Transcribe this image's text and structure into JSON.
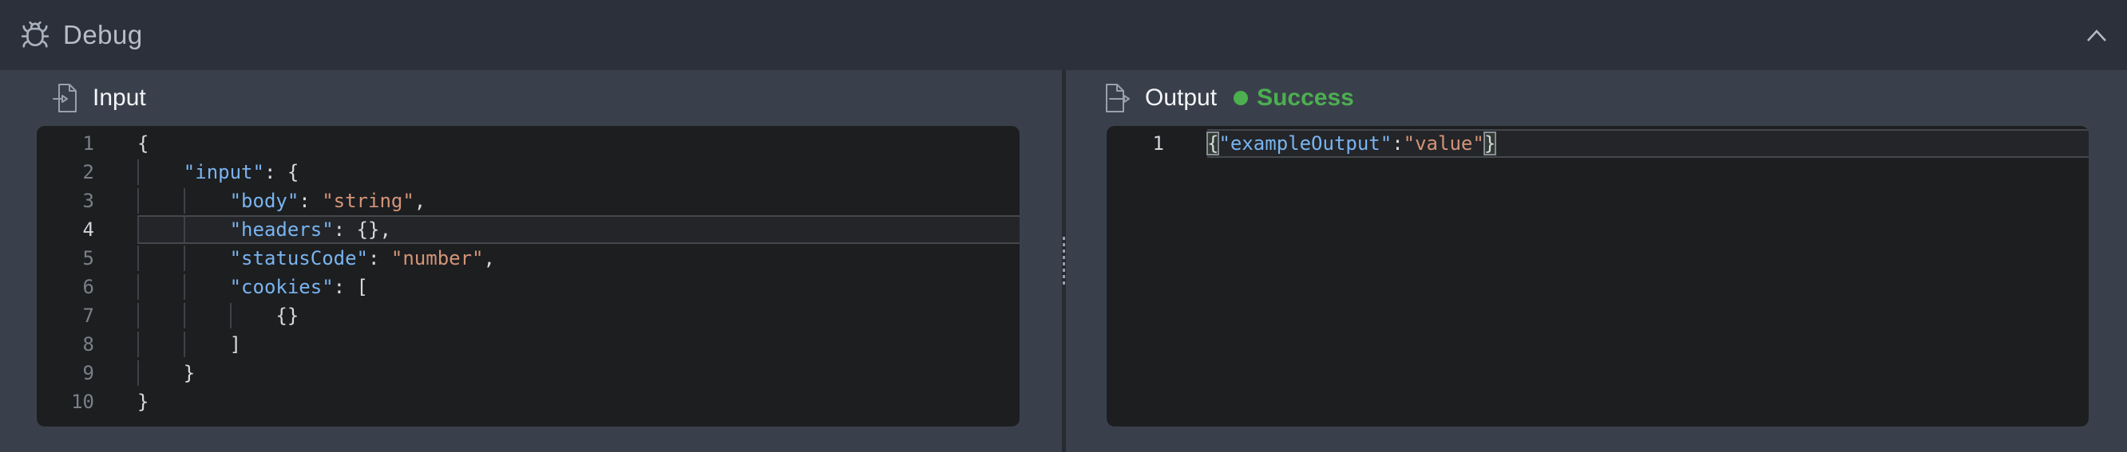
{
  "header": {
    "title": "Debug",
    "icon": "bug",
    "collapse_icon": "chevron-up"
  },
  "panels": {
    "input": {
      "title": "Input",
      "icon": "document-import"
    },
    "output": {
      "title": "Output",
      "icon": "document-export",
      "status": {
        "label": "Success",
        "color": "#4caf50"
      }
    }
  },
  "colors": {
    "success_green": "#4caf50",
    "syntax_key": "#79b4ef",
    "syntax_string": "#d49478",
    "syntax_punct": "#d8dadd",
    "editor_background": "#1d1e20",
    "header_background": "#2b303a",
    "page_background": "#3a404b"
  },
  "editors": {
    "input": {
      "language": "json",
      "active_line": 4,
      "lines": [
        {
          "n": 1,
          "tokens": [
            {
              "t": "punct",
              "v": "{"
            }
          ]
        },
        {
          "n": 2,
          "tokens": [
            {
              "t": "ws",
              "v": "    "
            },
            {
              "t": "key",
              "v": "\"input\""
            },
            {
              "t": "punct",
              "v": ": {"
            }
          ]
        },
        {
          "n": 3,
          "tokens": [
            {
              "t": "ws",
              "v": "        "
            },
            {
              "t": "key",
              "v": "\"body\""
            },
            {
              "t": "punct",
              "v": ": "
            },
            {
              "t": "str",
              "v": "\"string\""
            },
            {
              "t": "punct",
              "v": ","
            }
          ]
        },
        {
          "n": 4,
          "tokens": [
            {
              "t": "ws",
              "v": "        "
            },
            {
              "t": "key",
              "v": "\"headers\""
            },
            {
              "t": "punct",
              "v": ": {},"
            }
          ]
        },
        {
          "n": 5,
          "tokens": [
            {
              "t": "ws",
              "v": "        "
            },
            {
              "t": "key",
              "v": "\"statusCode\""
            },
            {
              "t": "punct",
              "v": ": "
            },
            {
              "t": "str",
              "v": "\"number\""
            },
            {
              "t": "punct",
              "v": ","
            }
          ]
        },
        {
          "n": 6,
          "tokens": [
            {
              "t": "ws",
              "v": "        "
            },
            {
              "t": "key",
              "v": "\"cookies\""
            },
            {
              "t": "punct",
              "v": ": ["
            }
          ]
        },
        {
          "n": 7,
          "tokens": [
            {
              "t": "ws",
              "v": "            "
            },
            {
              "t": "punct",
              "v": "{}"
            }
          ]
        },
        {
          "n": 8,
          "tokens": [
            {
              "t": "ws",
              "v": "        "
            },
            {
              "t": "punct",
              "v": "]"
            }
          ]
        },
        {
          "n": 9,
          "tokens": [
            {
              "t": "ws",
              "v": "    "
            },
            {
              "t": "punct",
              "v": "}"
            }
          ]
        },
        {
          "n": 10,
          "tokens": [
            {
              "t": "punct",
              "v": "}"
            }
          ]
        }
      ]
    },
    "output": {
      "language": "json",
      "active_line": 1,
      "lines": [
        {
          "n": 1,
          "tokens": [
            {
              "t": "bracket",
              "v": "{"
            },
            {
              "t": "key",
              "v": "\"exampleOutput\""
            },
            {
              "t": "punct",
              "v": ":"
            },
            {
              "t": "str",
              "v": "\"value\""
            },
            {
              "t": "bracket",
              "v": "}"
            }
          ]
        }
      ]
    }
  }
}
